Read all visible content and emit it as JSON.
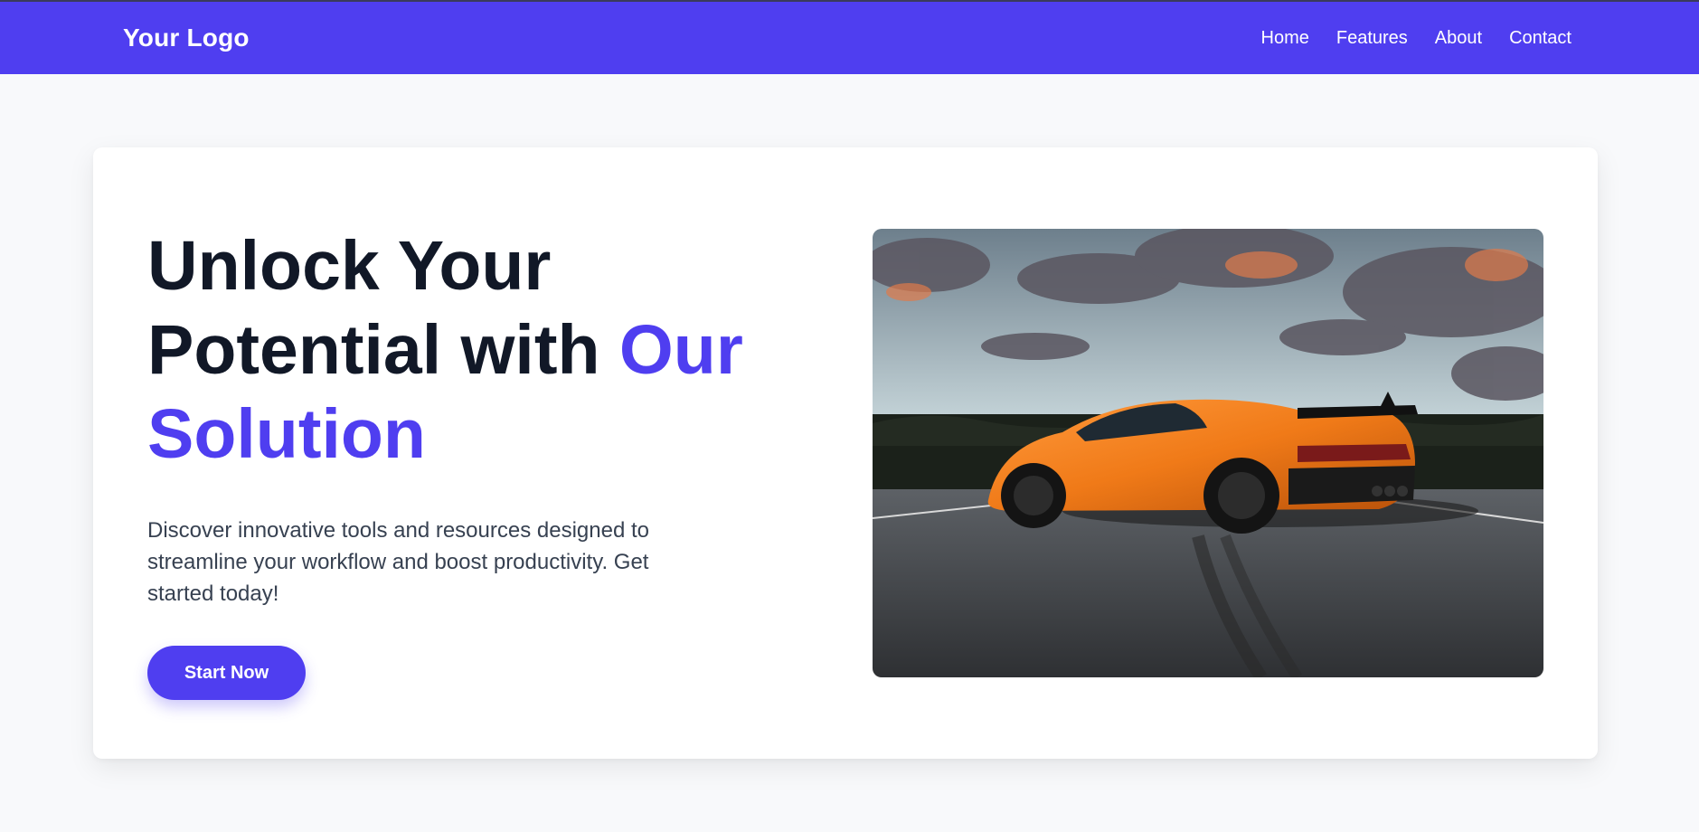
{
  "header": {
    "logo_text": "Your Logo",
    "nav_items": [
      "Home",
      "Features",
      "About",
      "Contact"
    ]
  },
  "hero": {
    "headline_line1": "Unlock Your",
    "headline_line2_plain": "Potential with ",
    "headline_line2_accent": "Our",
    "headline_line3_accent": "Solution",
    "subtext": "Discover innovative tools and resources designed to streamline your workflow and boost productivity. Get started today!",
    "cta_label": "Start Now",
    "image_subject": "orange-sports-car-photo"
  },
  "colors": {
    "brand": "#4f3ef0",
    "heading": "#111827",
    "body_text": "#374151",
    "page_background": "#f8f9fb",
    "card_background": "#ffffff"
  }
}
